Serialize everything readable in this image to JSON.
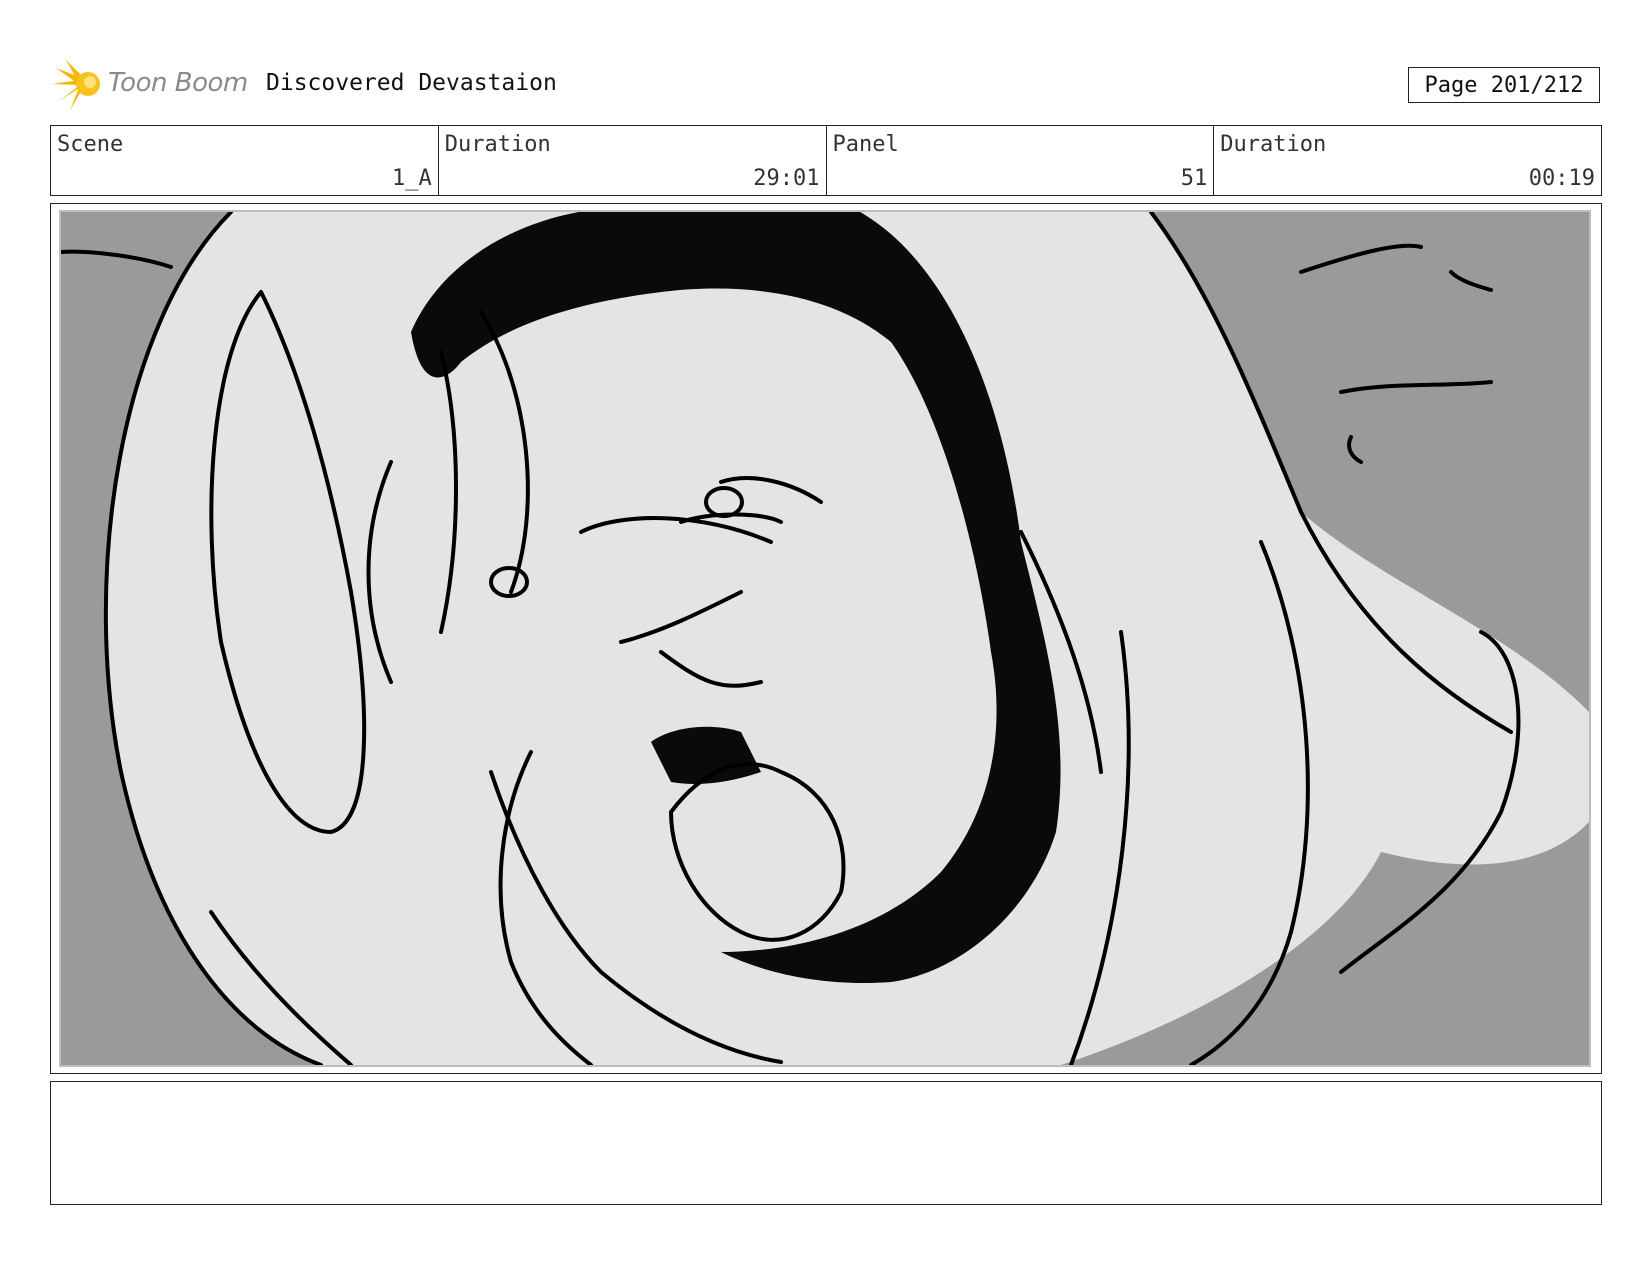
{
  "header": {
    "logo_text": "Toon Boom",
    "title": "Discovered Devastaion",
    "page_label": "Page 201/212"
  },
  "info": {
    "scene_label": "Scene",
    "scene_value": "1_A",
    "scene_duration_label": "Duration",
    "scene_duration_value": "29:01",
    "panel_label": "Panel",
    "panel_value": "51",
    "panel_duration_label": "Duration",
    "panel_duration_value": "00:19"
  },
  "notes": {
    "text": ""
  },
  "colors": {
    "logo_sun": "#f5b800",
    "background_gray": "#9a9a9a",
    "sketch_fill": "#e4e4e4"
  },
  "icons": {
    "logo": "toon-boom-sun-logo"
  }
}
